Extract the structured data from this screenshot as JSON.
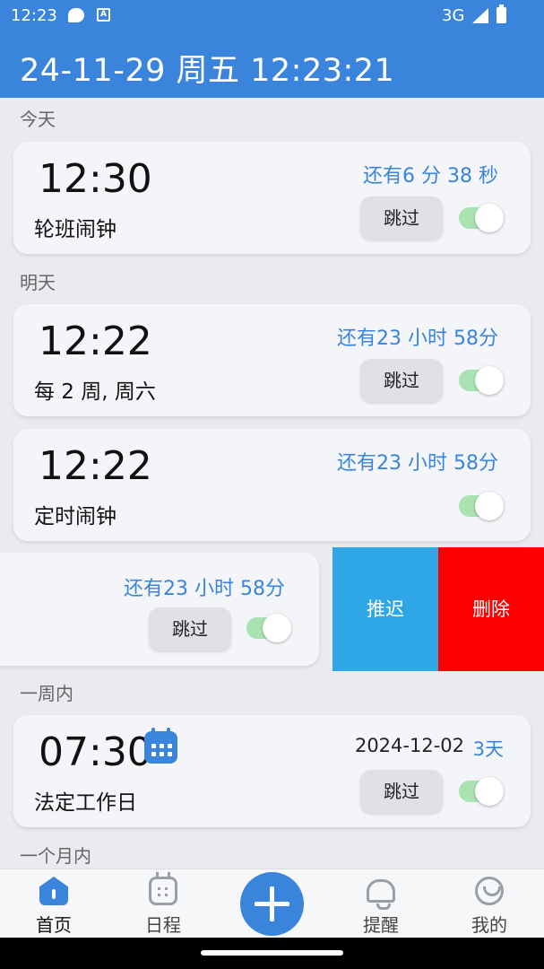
{
  "status_bar": {
    "time": "12:23",
    "network": "3G",
    "icon_a": "A"
  },
  "header": {
    "datetime": "24-11-29 周五 12:23:21"
  },
  "sections": {
    "today": "今天",
    "tomorrow": "明天",
    "week": "一周内",
    "month": "一个月内"
  },
  "alarms": [
    {
      "time": "12:30",
      "label": "轮班闹钟",
      "remaining": "还有6 分 38 秒",
      "skip": "跳过",
      "enabled": true
    },
    {
      "time": "12:22",
      "label": "每 2 周, 周六",
      "remaining": "还有23 小时 58分",
      "skip": "跳过",
      "enabled": true
    },
    {
      "time": "12:22",
      "label": "定时闹钟",
      "remaining": "还有23 小时 58分",
      "enabled": true
    },
    {
      "remaining": "还有23 小时 58分",
      "skip": "跳过",
      "enabled": true
    },
    {
      "time": "07:30",
      "label": "法定工作日",
      "date": "2024-12-02",
      "days": "3天",
      "skip": "跳过",
      "enabled": true
    }
  ],
  "swipe_actions": {
    "delay": "推迟",
    "delete": "删除"
  },
  "nav": {
    "home": "首页",
    "schedule": "日程",
    "remind": "提醒",
    "mine": "我的"
  },
  "icons": {
    "home": "home-icon",
    "schedule": "calendar-icon",
    "remind": "bell-icon",
    "mine": "smiley-icon",
    "add": "plus-icon",
    "calendar_badge": "calendar-icon"
  },
  "colors": {
    "primary": "#3a84dc",
    "delay": "#2fa7e6",
    "delete": "#fb0000",
    "toggle_on": "#a9e3b2"
  }
}
